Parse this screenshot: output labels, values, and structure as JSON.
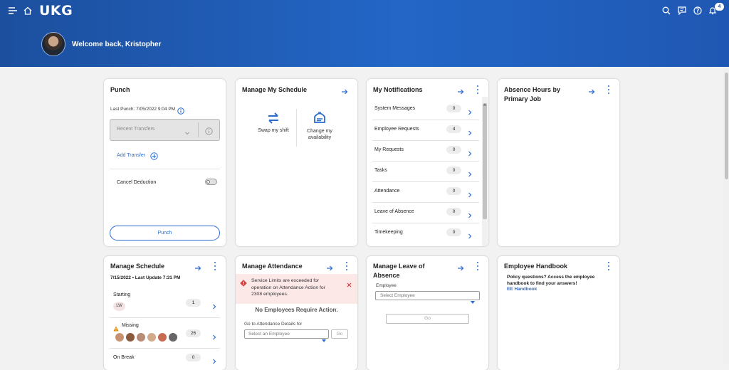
{
  "header": {
    "logo": "UKG",
    "welcome": "Welcome back, Kristopher",
    "notifications_badge": "4"
  },
  "punch": {
    "title": "Punch",
    "last_punch": "Last Punch: 7/05/2022 9:04 PM",
    "transfers_placeholder": "Recent Transfers",
    "add_transfer": "Add Transfer",
    "cancel_deduction": "Cancel Deduction",
    "punch_button": "Punch"
  },
  "manage_my_schedule": {
    "title": "Manage My Schedule",
    "swap_label": "Swap my shift",
    "availability_label": "Change my availability"
  },
  "my_notifications": {
    "title": "My Notifications",
    "items": [
      {
        "label": "System Messages",
        "count": "0"
      },
      {
        "label": "Employee Requests",
        "count": "4"
      },
      {
        "label": "My Requests",
        "count": "0"
      },
      {
        "label": "Tasks",
        "count": "0"
      },
      {
        "label": "Attendance",
        "count": "0"
      },
      {
        "label": "Leave of Absence",
        "count": "0"
      },
      {
        "label": "Timekeeping",
        "count": "0"
      }
    ]
  },
  "absence_hours": {
    "title": "Absence Hours by Primary Job"
  },
  "manage_schedule": {
    "title": "Manage Schedule",
    "subtitle": "7/15/2022 • Last Update 7:31 PM",
    "starting_label": "Starting",
    "starting_count": "1",
    "starting_initials": "LW",
    "missing_label": "Missing",
    "missing_count": "26",
    "on_break_label": "On Break",
    "on_break_count": "0"
  },
  "manage_attendance": {
    "title": "Manage Attendance",
    "alert": "Service Limits are exceeded for operation on Attendance Action for 2308 employees.",
    "no_action": "No Employees Require Action.",
    "goto_label": "Go to Attendance Details for",
    "select_placeholder": "Select an Employee",
    "go_button": "Go"
  },
  "manage_leave": {
    "title": "Manage Leave of Absence",
    "employee_label": "Employee",
    "select_placeholder": "Select Employee",
    "go_button": "Go"
  },
  "employee_handbook": {
    "title": "Employee Handbook",
    "text": "Policy questions? Access the employee handbook to find your answers!",
    "link": "EE Handbook"
  },
  "colors": {
    "header_start": "#1c4f9e",
    "header_end": "#2366c6",
    "accent": "#2a6bd1",
    "alert_bg": "#fde8e8",
    "alert_icon": "#d93a3a",
    "warning_icon": "#e08a00"
  }
}
